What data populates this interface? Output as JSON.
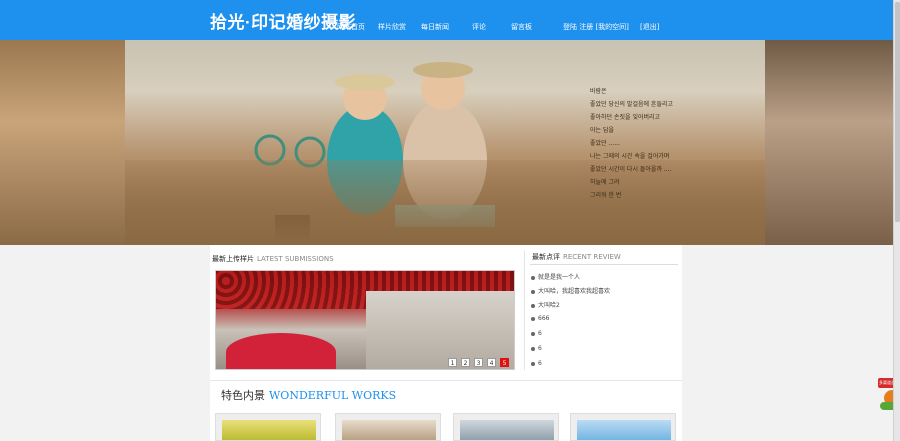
{
  "header": {
    "logo": "拾光·印记婚纱摄影",
    "nav": [
      "网站首页",
      "样片欣赏",
      "每日新闻",
      "评论",
      "留言板"
    ],
    "login": "登陆  注册 [我的空间]",
    "logout": "[退出]",
    "colors": {
      "bar": "#1e90ee",
      "text": "#ffffff"
    }
  },
  "banner": {
    "poem": [
      "바람은",
      "좋았던 당신의 발걸음에 흔들리고",
      "좋아하던 손짓을 잊어버리고",
      "아는 답을",
      "좋았던 ......",
      "나는 그때의 시간 속을 걸어가며",
      "좋았던 시간이 다시 돌아올까 ....",
      "하늘에 그려",
      "그리워 한 번"
    ]
  },
  "latest": {
    "title": "最新上传样片",
    "title_en": "LATEST SUBMISSIONS",
    "pager": [
      "1",
      "2",
      "3",
      "4",
      "5"
    ],
    "active_page": "5"
  },
  "reviews": {
    "title": "最新点评",
    "title_en": "RECENT REVIEW",
    "items": [
      "就是是我一个人",
      "大叫哈，我超喜欢我超喜欢",
      "大叫哈2",
      "666",
      "6",
      "6",
      "6"
    ]
  },
  "works": {
    "title": "特色内景",
    "title_en": "WONDERFUL WORKS"
  },
  "float": {
    "label": "多渠道咨询"
  }
}
